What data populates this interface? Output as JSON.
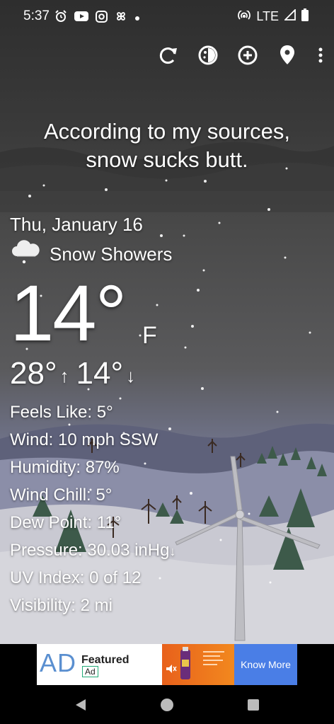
{
  "status_bar": {
    "time": "5:37",
    "network": "LTE",
    "icons": [
      "alarm-icon",
      "youtube-icon",
      "instagram-icon",
      "pinwheel-icon",
      "dot-icon",
      "hotspot-icon",
      "signal-icon",
      "battery-icon"
    ]
  },
  "toolbar": {
    "icons": [
      "refresh-icon",
      "theme-icon",
      "add-location-icon",
      "location-pin-icon",
      "overflow-menu-icon"
    ]
  },
  "slogan": {
    "line1": "According to my sources,",
    "line2": "snow sucks butt."
  },
  "weather": {
    "date": "Thu, January 16",
    "condition": "Snow Showers",
    "condition_icon": "snow-cloud-icon",
    "temperature": "14°",
    "unit": "F",
    "high": "28°",
    "low": "14°",
    "details": [
      {
        "label": "Feels Like:",
        "value": "5°"
      },
      {
        "label": "Wind:",
        "value": "10 mph SSW"
      },
      {
        "label": "Humidity:",
        "value": "87%"
      },
      {
        "label": "Wind Chill:",
        "value": "5°"
      },
      {
        "label": "Dew Point:",
        "value": "11°"
      },
      {
        "label": "Pressure:",
        "value": "30.03 inHg",
        "trend_icon": "falling-arrow-icon"
      },
      {
        "label": "UV Index:",
        "value": "0 of 12"
      },
      {
        "label": "Visibility:",
        "value": "2 mi"
      }
    ]
  },
  "ad": {
    "logo": "AD",
    "featured": "Featured",
    "tag": "Ad",
    "cta": "Know More"
  },
  "nav": {
    "icons": [
      "back-icon",
      "home-icon",
      "recents-icon"
    ]
  }
}
